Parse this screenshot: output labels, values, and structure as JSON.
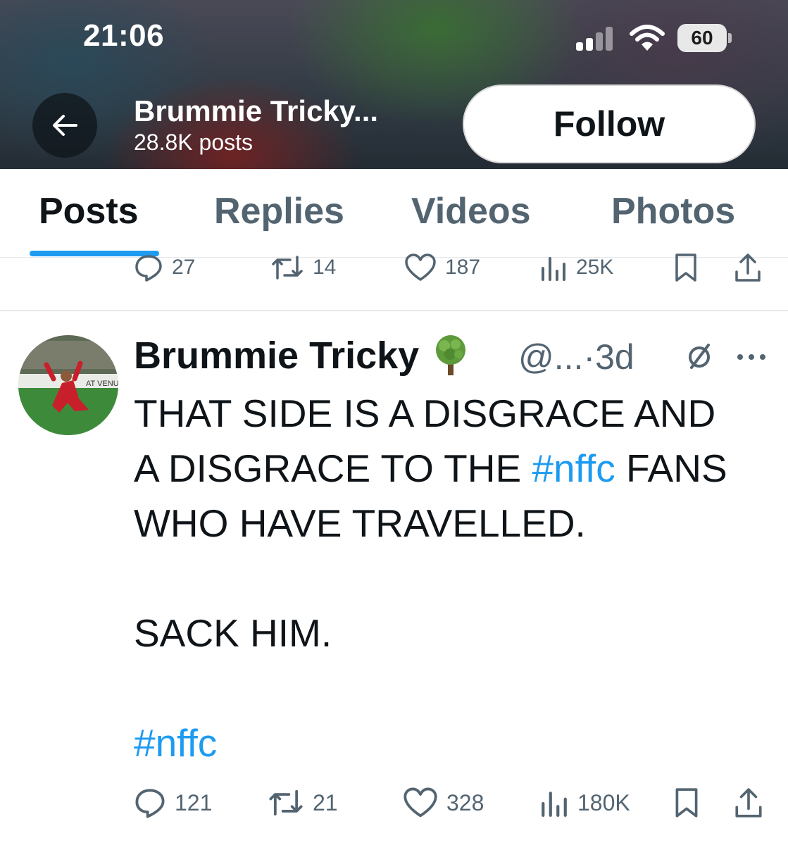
{
  "status_bar": {
    "time": "21:06",
    "battery": "60"
  },
  "header": {
    "profile_name": "Brummie Tricky...",
    "post_count": "28.8K posts",
    "follow_label": "Follow"
  },
  "tabs": [
    {
      "label": "Posts",
      "active": true
    },
    {
      "label": "Replies",
      "active": false
    },
    {
      "label": "Videos",
      "active": false
    },
    {
      "label": "Photos",
      "active": false
    }
  ],
  "previous_post_actions": {
    "replies": "27",
    "reposts": "14",
    "likes": "187",
    "views": "25K"
  },
  "post": {
    "author": "Brummie Tricky",
    "handle": "@...",
    "separator": "·",
    "time": "3d",
    "lines": [
      {
        "parts": [
          {
            "text": "THAT SIDE IS A DISGRACE AND",
            "tag": false
          }
        ]
      },
      {
        "parts": [
          {
            "text": "A DISGRACE TO THE ",
            "tag": false
          },
          {
            "text": "#nffc",
            "tag": true
          },
          {
            "text": " FANS",
            "tag": false
          }
        ]
      },
      {
        "parts": [
          {
            "text": "WHO HAVE TRAVELLED.",
            "tag": false
          }
        ]
      },
      {
        "parts": [
          {
            "text": "",
            "tag": false
          }
        ]
      },
      {
        "parts": [
          {
            "text": "SACK HIM.",
            "tag": false
          }
        ]
      },
      {
        "parts": [
          {
            "text": "",
            "tag": false
          }
        ]
      },
      {
        "parts": [
          {
            "text": "#nffc",
            "tag": true
          }
        ]
      }
    ],
    "actions": {
      "replies": "121",
      "reposts": "21",
      "likes": "328",
      "views": "180K"
    }
  },
  "colors": {
    "accent": "#1d9bf0",
    "text": "#0f1419",
    "secondary": "#536471"
  },
  "icons": [
    "back-arrow-icon",
    "signal-icon",
    "wifi-icon",
    "battery-icon",
    "reply-icon",
    "repost-icon",
    "like-icon",
    "views-icon",
    "bookmark-icon",
    "share-icon",
    "tree-badge-icon",
    "mute-icon",
    "more-icon"
  ]
}
